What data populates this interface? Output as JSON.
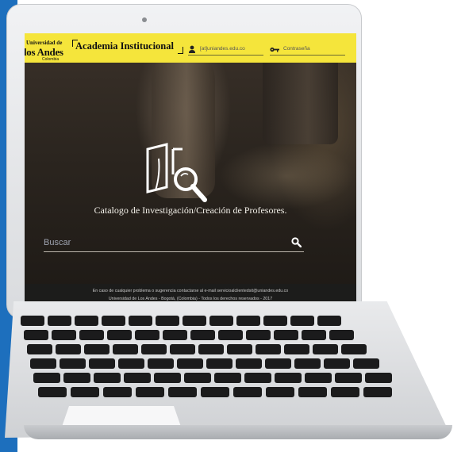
{
  "header": {
    "university_line1": "Universidad de",
    "university_line2": "los Andes",
    "university_line3": "Colombia",
    "brand": "Academia Institucional",
    "username_placeholder": "[at]uniandes.edu.co",
    "password_placeholder": "Contraseña"
  },
  "hero": {
    "tagline": "Catalogo de Investigación/Creación de Profesores.",
    "search_placeholder": "Buscar"
  },
  "footer": {
    "line1": "En caso de cualquier problema o sugerencia contactarse al e-mail servicioalclientedsit@uniandes.edu.co",
    "line2": "Universidad de Los Andes - Bogotá, (Colombia) - Todos los derechos reservados - 2017"
  },
  "colors": {
    "header_bg": "#f5e53b",
    "side_strip": "#1d6fbd",
    "footer_bg": "#1c1c1c"
  },
  "icons": [
    "user-icon",
    "key-icon",
    "book-search-icon",
    "search-icon"
  ]
}
